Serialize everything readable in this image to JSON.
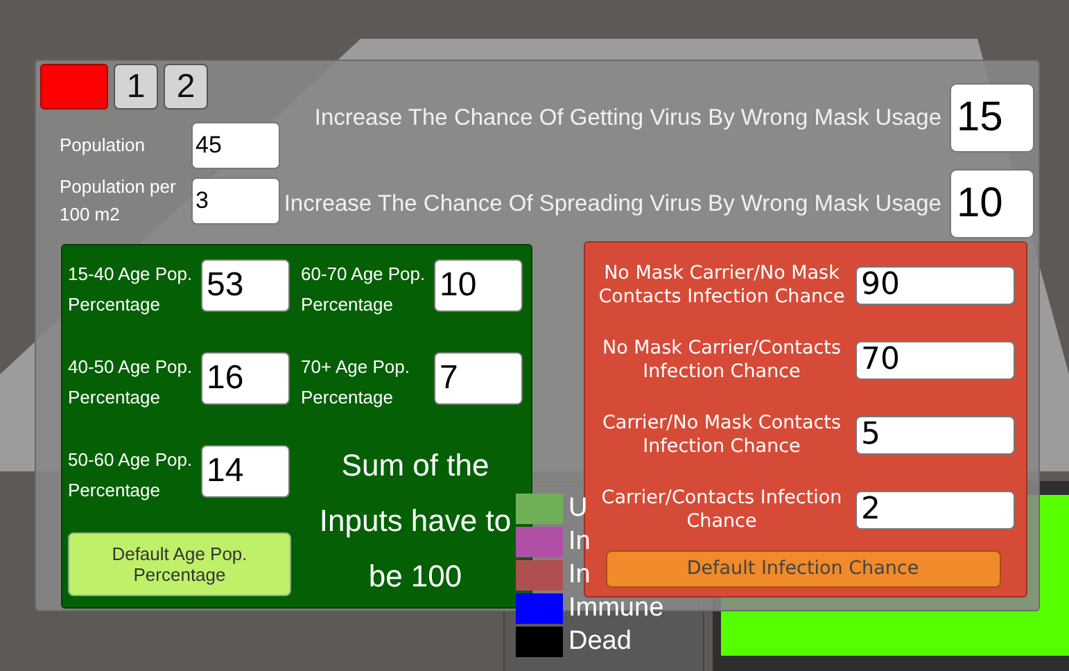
{
  "tabs": [
    {
      "label": "1"
    },
    {
      "label": "2"
    }
  ],
  "population_fields": [
    {
      "label": "Population",
      "value": "45"
    },
    {
      "label": "Population per 100 m2",
      "value": "3"
    }
  ],
  "mask_settings": [
    {
      "label": "Increase The Chance Of Getting Virus By Wrong Mask Usage",
      "value": "15"
    },
    {
      "label": "Increase The Chance Of Spreading Virus By Wrong Mask Usage",
      "value": "10"
    }
  ],
  "age_panel": {
    "fields": [
      {
        "label": "15-40 Age Pop. Percentage",
        "value": "53"
      },
      {
        "label": "60-70 Age Pop. Percentage",
        "value": "10"
      },
      {
        "label": "40-50 Age Pop. Percentage",
        "value": "16"
      },
      {
        "label": "70+ Age Pop. Percentage",
        "value": "7"
      },
      {
        "label": "50-60 Age Pop. Percentage",
        "value": "14"
      }
    ],
    "button": "Default Age Pop. Percentage",
    "note": "Sum of the Inputs have to be 100"
  },
  "infection_panel": {
    "fields": [
      {
        "label": "No Mask Carrier/No Mask Contacts Infection Chance",
        "value": "90"
      },
      {
        "label": "No Mask Carrier/Contacts Infection Chance",
        "value": "70"
      },
      {
        "label": "Carrier/No Mask Contacts Infection Chance",
        "value": "5"
      },
      {
        "label": "Carrier/Contacts Infection Chance",
        "value": "2"
      }
    ],
    "button": "Default Infection Chance"
  },
  "legend": [
    {
      "label": "U",
      "color": "#6fb056"
    },
    {
      "label": "In",
      "color": "#b04fa6"
    },
    {
      "label": "In",
      "color": "#b04f4f"
    },
    {
      "label": "Immune",
      "color": "#0000ff"
    },
    {
      "label": "Dead",
      "color": "#000000"
    }
  ]
}
